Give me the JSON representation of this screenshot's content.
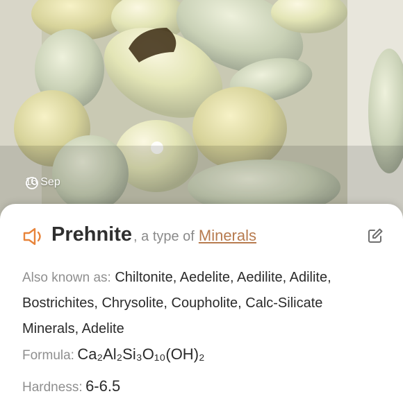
{
  "photo": {
    "date": "16 Sep",
    "clock_icon": "clock-icon"
  },
  "plant_card": {
    "name": "Prehnite",
    "type_prefix": ", a type of",
    "type_link": "Minerals",
    "speaker_icon": "speaker-icon",
    "edit_icon": "edit-icon",
    "accent_color": "#e8843a",
    "link_color": "#b77b4f"
  },
  "details": {
    "also_known_label": "Also known as:",
    "also_known_value": "Chiltonite, Aedelite, Aedilite, Adilite, Bostrichites, Chrysolite, Coupholite, Calc-Silicate Minerals, Adelite",
    "formula_label": "Formula:",
    "formula_value": "Ca₂Al₂Si₃O₁₀(OH)₂",
    "hardness_label": "Hardness:",
    "hardness_value": "6-6.5"
  }
}
